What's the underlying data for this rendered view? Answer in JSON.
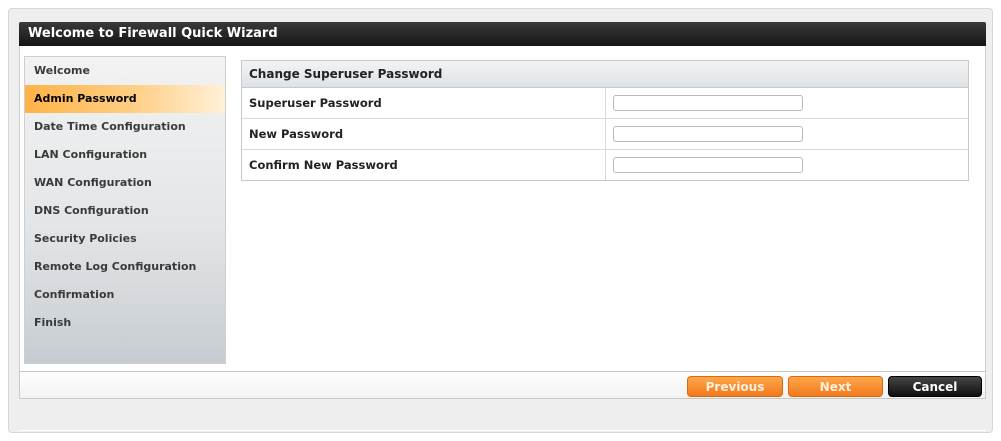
{
  "window": {
    "title": "Welcome to Firewall Quick Wizard"
  },
  "sidebar": {
    "items": [
      {
        "label": "Welcome",
        "active": false
      },
      {
        "label": "Admin Password",
        "active": true
      },
      {
        "label": "Date Time Configuration",
        "active": false
      },
      {
        "label": "LAN Configuration",
        "active": false
      },
      {
        "label": "WAN Configuration",
        "active": false
      },
      {
        "label": "DNS Configuration",
        "active": false
      },
      {
        "label": "Security Policies",
        "active": false
      },
      {
        "label": "Remote Log Configuration",
        "active": false
      },
      {
        "label": "Confirmation",
        "active": false
      },
      {
        "label": "Finish",
        "active": false
      }
    ]
  },
  "panel": {
    "title": "Change Superuser Password",
    "fields": [
      {
        "label": "Superuser Password",
        "value": ""
      },
      {
        "label": "New Password",
        "value": ""
      },
      {
        "label": "Confirm New Password",
        "value": ""
      }
    ]
  },
  "buttons": {
    "previous": "Previous",
    "next": "Next",
    "cancel": "Cancel"
  },
  "colors": {
    "accent": "#f2791d",
    "titlebar": "#1a1a1a",
    "active_item": "#ffb347"
  }
}
